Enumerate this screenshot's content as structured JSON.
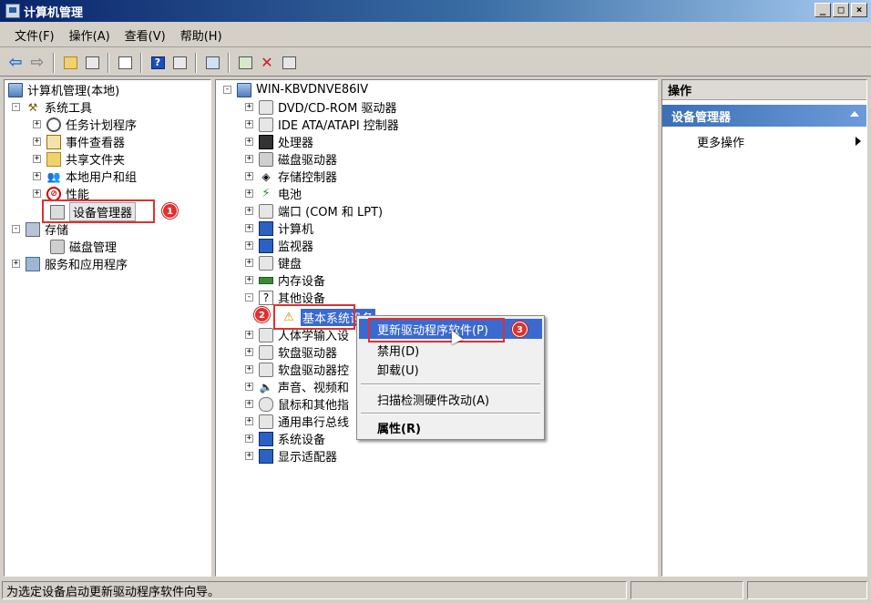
{
  "window": {
    "title": "计算机管理",
    "minimize": "_",
    "restore": "□",
    "close": "×"
  },
  "menu": [
    "文件(F)",
    "操作(A)",
    "查看(V)",
    "帮助(H)"
  ],
  "toolbar": {
    "help_glyph": "?"
  },
  "left_tree": {
    "root": "计算机管理(本地)",
    "items": [
      {
        "label": "系统工具",
        "expander": "-"
      },
      {
        "label": "任务计划程序",
        "expander": "+"
      },
      {
        "label": "事件查看器",
        "expander": "+"
      },
      {
        "label": "共享文件夹",
        "expander": "+"
      },
      {
        "label": "本地用户和组",
        "expander": "+"
      },
      {
        "label": "性能",
        "expander": "+"
      },
      {
        "label": "设备管理器",
        "expander": ""
      },
      {
        "label": "存储",
        "expander": "-"
      },
      {
        "label": "磁盘管理",
        "expander": ""
      },
      {
        "label": "服务和应用程序",
        "expander": "+"
      }
    ]
  },
  "device_tree": {
    "root": "WIN-KBVDNVE86IV",
    "root_expander": "-",
    "items": [
      {
        "label": "DVD/CD-ROM 驱动器",
        "expander": "+"
      },
      {
        "label": "IDE ATA/ATAPI 控制器",
        "expander": "+"
      },
      {
        "label": "处理器",
        "expander": "+"
      },
      {
        "label": "磁盘驱动器",
        "expander": "+"
      },
      {
        "label": "存储控制器",
        "expander": "+"
      },
      {
        "label": "电池",
        "expander": "+"
      },
      {
        "label": "端口 (COM 和 LPT)",
        "expander": "+"
      },
      {
        "label": "计算机",
        "expander": "+"
      },
      {
        "label": "监视器",
        "expander": "+"
      },
      {
        "label": "键盘",
        "expander": "+"
      },
      {
        "label": "内存设备",
        "expander": "+"
      },
      {
        "label": "其他设备",
        "expander": "-"
      },
      {
        "label": "基本系统设备",
        "expander": ""
      },
      {
        "label": "人体学输入设",
        "expander": "+"
      },
      {
        "label": "软盘驱动器",
        "expander": "+"
      },
      {
        "label": "软盘驱动器控",
        "expander": "+"
      },
      {
        "label": "声音、视频和",
        "expander": "+"
      },
      {
        "label": "鼠标和其他指",
        "expander": "+"
      },
      {
        "label": "通用串行总线",
        "expander": "+"
      },
      {
        "label": "系统设备",
        "expander": "+"
      },
      {
        "label": "显示适配器",
        "expander": "+"
      }
    ]
  },
  "context_menu": {
    "update": "更新驱动程序软件(P)",
    "disable": "禁用(D)",
    "uninstall": "卸载(U)",
    "scan": "扫描检测硬件改动(A)",
    "properties": "属性(R)"
  },
  "actions": {
    "header": "操作",
    "section": "设备管理器",
    "more": "更多操作"
  },
  "badges": [
    "1",
    "2",
    "3"
  ],
  "status": {
    "text": "为选定设备启动更新驱动程序软件向导。"
  },
  "colors": {
    "title_start": "#0a246a",
    "highlight": "#3a6ad0",
    "annotation": "#e03030"
  }
}
